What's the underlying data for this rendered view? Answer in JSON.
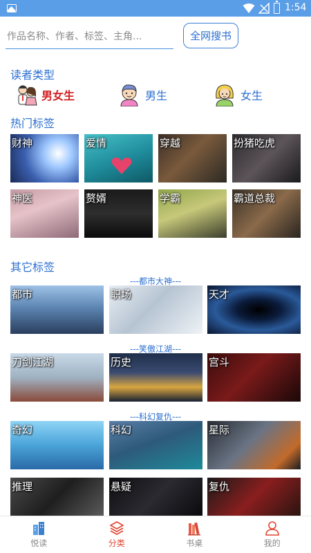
{
  "status_bar": {
    "time": "1:54"
  },
  "search": {
    "placeholder": "作品名称、作者、标签、主角...",
    "button_label": "全网搜书"
  },
  "reader_types": {
    "title": "读者类型",
    "items": [
      {
        "label": "男女生",
        "color": "#d32020"
      },
      {
        "label": "男生",
        "color": "#2a6fd0"
      },
      {
        "label": "女生",
        "color": "#2a6fd0"
      }
    ]
  },
  "hot_tags": {
    "title": "热门标签",
    "items": [
      "财神",
      "爱情",
      "穿越",
      "扮猪吃虎",
      "神医",
      "赘婿",
      "学霸",
      "霸道总裁"
    ]
  },
  "other_tags": {
    "title": "其它标签",
    "groups": [
      {
        "title": "---都市大神---",
        "items": [
          "都市",
          "职场",
          "天才"
        ]
      },
      {
        "title": "---笑傲江湖---",
        "items": [
          "刀剑江湖",
          "历史",
          "宫斗"
        ]
      },
      {
        "title": "---科幻复仇---",
        "items": [
          "奇幻",
          "科幻",
          "星际"
        ]
      },
      {
        "title": "",
        "items": [
          "推理",
          "悬疑",
          "复仇"
        ]
      }
    ]
  },
  "bottom_nav": {
    "items": [
      {
        "label": "悦读",
        "active": false
      },
      {
        "label": "分类",
        "active": true
      },
      {
        "label": "书桌",
        "active": false
      },
      {
        "label": "我的",
        "active": false
      }
    ]
  }
}
